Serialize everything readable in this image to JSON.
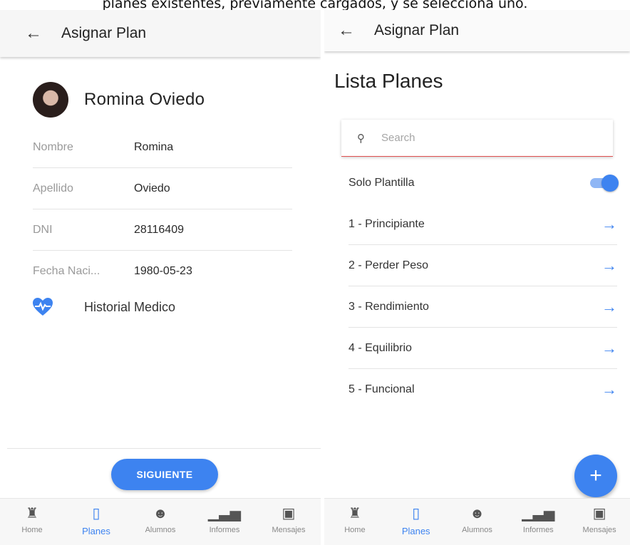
{
  "caption": "planes existentes, previamente cargados, y se selecciona uno.",
  "left": {
    "appbar": {
      "title": "Asignar Plan",
      "back_icon": "arrow-left-icon"
    },
    "profile": {
      "name": "Romina Oviedo",
      "fields": [
        {
          "label": "Nombre",
          "value": "Romina"
        },
        {
          "label": "Apellido",
          "value": "Oviedo"
        },
        {
          "label": "DNI",
          "value": "28116409"
        },
        {
          "label": "Fecha Naci...",
          "value": "1980-05-23"
        }
      ],
      "history_label": "Historial Medico",
      "history_icon": "heart-pulse-icon"
    },
    "next_button": "SIGUIENTE"
  },
  "right": {
    "appbar": {
      "title": "Asignar Plan",
      "back_icon": "arrow-left-icon"
    },
    "list_title": "Lista Planes",
    "search": {
      "placeholder": "Search"
    },
    "toggle": {
      "label": "Solo Plantilla",
      "on": true
    },
    "plans": [
      "1 - Principiante",
      "2 - Perder Peso",
      "3 - Rendimiento",
      "4 - Equilibrio",
      "5 - Funcional"
    ],
    "fab_icon": "plus-icon"
  },
  "nav": {
    "items": [
      {
        "label": "Home",
        "icon": "home-icon",
        "active": false
      },
      {
        "label": "Planes",
        "icon": "clipboard-icon",
        "active": true
      },
      {
        "label": "Alumnos",
        "icon": "people-icon",
        "active": false
      },
      {
        "label": "Informes",
        "icon": "bar-chart-icon",
        "active": false
      },
      {
        "label": "Mensajes",
        "icon": "chat-icon",
        "active": false
      }
    ]
  },
  "colors": {
    "accent": "#3d83f0",
    "search_underline": "#e05050"
  }
}
